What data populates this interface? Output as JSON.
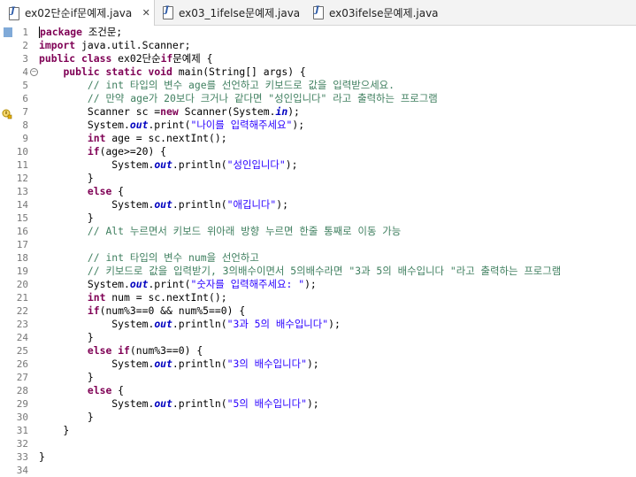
{
  "tabs": [
    {
      "label": "ex02단순if문예제.java",
      "active": true,
      "close": "✕"
    },
    {
      "label": "ex03_1ifelse문예제.java",
      "active": false
    },
    {
      "label": "ex03ifelse문예제.java",
      "active": false
    }
  ],
  "icons": {
    "java_file": "java-file-icon",
    "fold": "collapse-toggle-icon",
    "warning": "warning-icon",
    "bookmark": "quick-diff-marker-icon"
  },
  "colors": {
    "keyword": "#7f0055",
    "comment": "#3f7f5f",
    "string": "#2a00ff",
    "field": "#0000c0",
    "line_number": "#787878"
  },
  "code": [
    {
      "n": "1",
      "text": "package 조건문;"
    },
    {
      "n": "2",
      "text": "import java.util.Scanner;"
    },
    {
      "n": "3",
      "text": "public class ex02단순if문예제 {"
    },
    {
      "n": "4",
      "text": "    public static void main(String[] args) {"
    },
    {
      "n": "5",
      "text": "        // int 타입의 변수 age를 선언하고 키보드로 값을 입력받으세요."
    },
    {
      "n": "6",
      "text": "        // 만약 age가 20보다 크거나 같다면 \"성인입니다\" 라고 출력하는 프로그램"
    },
    {
      "n": "7",
      "text": "        Scanner sc =new Scanner(System.in);"
    },
    {
      "n": "8",
      "text": "        System.out.print(\"나이를 입력해주세요\");"
    },
    {
      "n": "9",
      "text": "        int age = sc.nextInt();"
    },
    {
      "n": "10",
      "text": "        if(age>=20) {"
    },
    {
      "n": "11",
      "text": "            System.out.println(\"성인입니다\");"
    },
    {
      "n": "12",
      "text": "        }"
    },
    {
      "n": "13",
      "text": "        else {"
    },
    {
      "n": "14",
      "text": "            System.out.println(\"애깁니다\");"
    },
    {
      "n": "15",
      "text": "        }"
    },
    {
      "n": "16",
      "text": "        // Alt 누르면서 키보드 위아래 방향 누르면 한줄 통째로 이동 가능"
    },
    {
      "n": "17",
      "text": ""
    },
    {
      "n": "18",
      "text": "        // int 타입의 변수 num을 선언하고"
    },
    {
      "n": "19",
      "text": "        // 키보드로 값을 입력받기, 3의배수이면서 5의배수라면 \"3과 5의 배수입니다 \"라고 출력하는 프로그램"
    },
    {
      "n": "20",
      "text": "        System.out.print(\"숫자를 입력해주세요: \");"
    },
    {
      "n": "21",
      "text": "        int num = sc.nextInt();"
    },
    {
      "n": "22",
      "text": "        if(num%3==0 && num%5==0) {"
    },
    {
      "n": "23",
      "text": "            System.out.println(\"3과 5의 배수입니다\");"
    },
    {
      "n": "24",
      "text": "        }"
    },
    {
      "n": "25",
      "text": "        else if(num%3==0) {"
    },
    {
      "n": "26",
      "text": "            System.out.println(\"3의 배수입니다\");"
    },
    {
      "n": "27",
      "text": "        }"
    },
    {
      "n": "28",
      "text": "        else {"
    },
    {
      "n": "29",
      "text": "            System.out.println(\"5의 배수입니다\");"
    },
    {
      "n": "30",
      "text": "        }"
    },
    {
      "n": "31",
      "text": "    }"
    },
    {
      "n": "32",
      "text": ""
    },
    {
      "n": "33",
      "text": "}"
    },
    {
      "n": "34",
      "text": ""
    }
  ]
}
